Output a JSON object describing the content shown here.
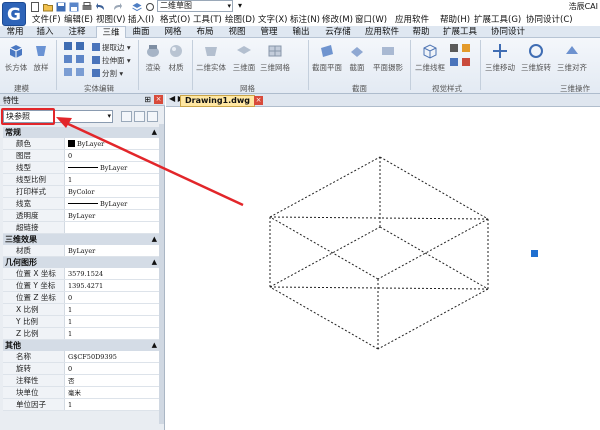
{
  "title_bar": {
    "app_logo": "G",
    "workspace": "二维草图",
    "app_title": "浩辰CAI"
  },
  "menu": [
    "文件(F)",
    "编辑(E)",
    "视图(V)",
    "插入(I)",
    "格式(O)",
    "工具(T)",
    "绘图(D)",
    "文字(X)",
    "标注(N)",
    "修改(M)",
    "窗口(W)",
    "应用软件",
    "帮助(H)",
    "扩展工具(G)",
    "协同设计(C)"
  ],
  "tabs": [
    "常用",
    "插入",
    "注释",
    "三维",
    "曲面",
    "网格",
    "布局",
    "视图",
    "管理",
    "输出",
    "云存储",
    "应用软件",
    "帮助",
    "扩展工具",
    "协同设计"
  ],
  "active_tab": "三维",
  "ribbon": {
    "modeling": {
      "title": "建模",
      "box": "长方体",
      "loft": "放样"
    },
    "solid_edit": {
      "title": "实体编辑",
      "extract_edges": "提取边",
      "extrude_face": "拉伸面",
      "separate": "分割"
    },
    "render": {
      "render": "渲染",
      "material": "材质"
    },
    "mesh": {
      "title": "网格",
      "solid_2d": "二维实体",
      "surface_3d": "三维面",
      "mesh_3d": "三维网格"
    },
    "section": {
      "title": "截面",
      "section_plane": "截面平面",
      "section": "截面",
      "plan_projection": "平面摄影"
    },
    "visual_style": {
      "title": "视觉样式",
      "wireframe_2d": "二维线框"
    },
    "ops_3d": {
      "title": "三维操作",
      "move_3d": "三维移动",
      "rotate_3d": "三维旋转",
      "align_3d": "三维对齐"
    }
  },
  "palette": {
    "title": "特性",
    "pin": "⊞",
    "close": "×",
    "selection": "块参照",
    "sections": [
      {
        "name": "常规",
        "rows": [
          {
            "k": "颜色",
            "v": "ByLayer",
            "swatch": true
          },
          {
            "k": "图层",
            "v": "0"
          },
          {
            "k": "线型",
            "v": "ByLayer",
            "line": true
          },
          {
            "k": "线型比例",
            "v": "1"
          },
          {
            "k": "打印样式",
            "v": "ByColor"
          },
          {
            "k": "线宽",
            "v": "ByLayer",
            "line": true
          },
          {
            "k": "透明度",
            "v": "ByLayer"
          },
          {
            "k": "超链接",
            "v": ""
          }
        ]
      },
      {
        "name": "三维效果",
        "rows": [
          {
            "k": "材质",
            "v": "ByLayer"
          }
        ]
      },
      {
        "name": "几何图形",
        "rows": [
          {
            "k": "位置 X 坐标",
            "v": "3579.1524"
          },
          {
            "k": "位置 Y 坐标",
            "v": "1395.4271"
          },
          {
            "k": "位置 Z 坐标",
            "v": "0"
          },
          {
            "k": "X 比例",
            "v": "1"
          },
          {
            "k": "Y 比例",
            "v": "1"
          },
          {
            "k": "Z 比例",
            "v": "1"
          }
        ]
      },
      {
        "name": "其他",
        "rows": [
          {
            "k": "名称",
            "v": "G$CF50D9395"
          },
          {
            "k": "旋转",
            "v": "0"
          },
          {
            "k": "注释性",
            "v": "否"
          },
          {
            "k": "块单位",
            "v": "毫米"
          },
          {
            "k": "单位因子",
            "v": "1"
          }
        ]
      }
    ]
  },
  "document": {
    "tab": "Drawing1.dwg",
    "nav": "◀ ▶",
    "close": "×"
  },
  "colors": {
    "highlight": "#e2262a",
    "arrow": "#e2262a",
    "grip": "#1f6fd0"
  }
}
